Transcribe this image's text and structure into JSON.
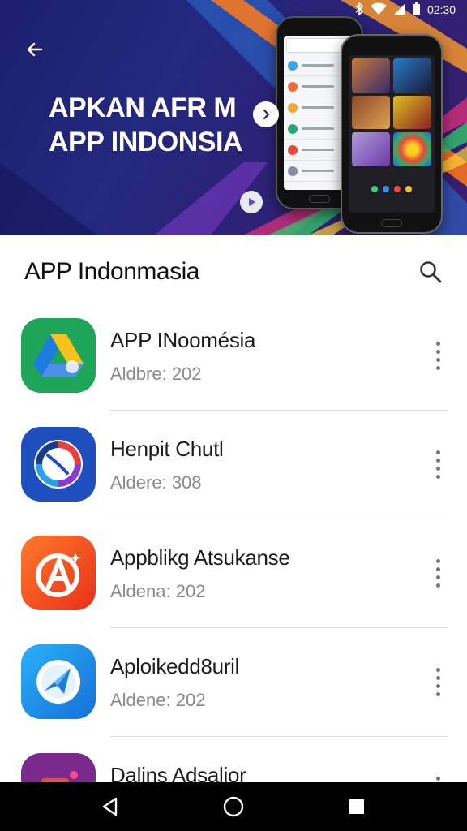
{
  "status_bar": {
    "time": "02:30",
    "icons": [
      "bluetooth-icon",
      "wifi-icon",
      "signal-icon",
      "battery-icon"
    ]
  },
  "hero": {
    "title_line1": "APKAN AFR M",
    "title_line2": "APP INDONSIA",
    "colors": {
      "bg": "#23297e",
      "accent_orange": "#ff7a1a",
      "accent_green": "#33c26b",
      "accent_pink": "#e8327a"
    }
  },
  "header": {
    "title": "APP Indonmasia",
    "search_icon": "search-icon"
  },
  "apps": [
    {
      "name": "APP INoomésia",
      "meta": "Aldbre: 202",
      "icon": "drive-like-icon",
      "icon_color": "#1ea55a"
    },
    {
      "name": "Henpit Chutl",
      "meta": "Aldere: 308",
      "icon": "compass-clock-icon",
      "icon_color": "#1f4fbf"
    },
    {
      "name": "Appblikg Atsukanse",
      "meta": "Aldena: 202",
      "icon": "letter-a-icon",
      "icon_color": "#f04a1a"
    },
    {
      "name": "Aploikedd8uril",
      "meta": "Aldene: 202",
      "icon": "paper-plane-icon",
      "icon_color": "#1e8fe6"
    },
    {
      "name": "Dalins Adsalior",
      "meta": "",
      "icon": "photo-icon",
      "icon_color": "#7a2a8c"
    }
  ],
  "nav": {
    "back": "back-triangle-icon",
    "home": "home-circle-icon",
    "recents": "recents-square-icon"
  }
}
